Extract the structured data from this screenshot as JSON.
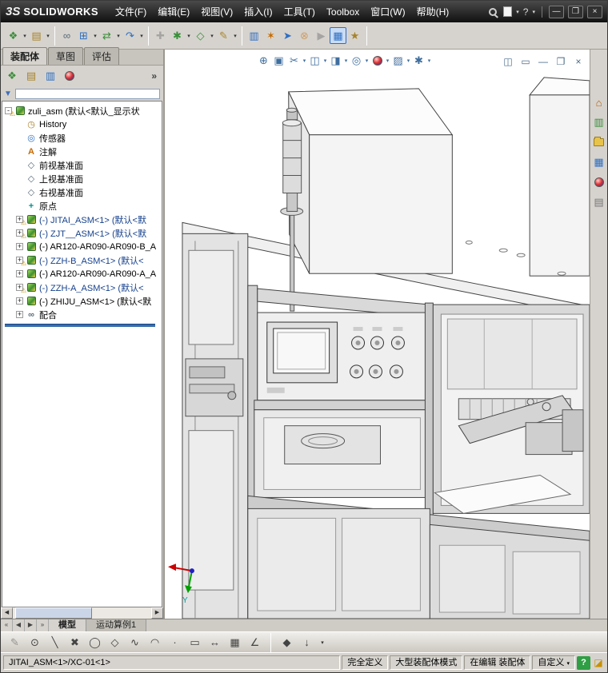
{
  "colors": {
    "accent_blue": "#2d6fc2",
    "tree_green": "#3b8f3b",
    "warning_yellow": "#c79100",
    "rollback_blue": "#3a6ea5",
    "help_green": "#2f9e44"
  },
  "titlebar": {
    "logo_mark": "3S",
    "logo_text": "SOLIDWORKS",
    "menus": [
      "文件(F)",
      "编辑(E)",
      "视图(V)",
      "插入(I)",
      "工具(T)",
      "Toolbox",
      "窗口(W)",
      "帮助(H)"
    ]
  },
  "icons": {
    "dropdown": "▾",
    "minimize": "—",
    "restore": "❐",
    "close": "×",
    "help": "?",
    "chevron": "»",
    "warning": "⚠",
    "history": "◷",
    "sensors": "◎",
    "annotations": "A",
    "plane": "◇",
    "origin": "+",
    "mates": "∞",
    "filter": "▼",
    "scroll_left": "◀",
    "scroll_right": "▶",
    "tip": "◪"
  },
  "toolbar": {
    "icons": [
      {
        "n": "insert-components",
        "g": "❖",
        "dd": true
      },
      {
        "n": "open-document",
        "g": "▤",
        "dd": true
      },
      {
        "n": "mate",
        "g": "∞",
        "dd": false
      },
      {
        "n": "linear-component-pattern",
        "g": "⊞",
        "dd": true
      },
      {
        "n": "move-component",
        "g": "⇄",
        "dd": true
      },
      {
        "n": "rotate-component",
        "g": "↷",
        "dd": true
      },
      {
        "n": "smart-fasteners",
        "g": "✚",
        "dd": false
      },
      {
        "n": "assembly-features",
        "g": "✱",
        "dd": true
      },
      {
        "n": "reference-geometry",
        "g": "◇",
        "dd": true
      },
      {
        "n": "new-sketch",
        "g": "✎",
        "dd": true
      },
      {
        "n": "bill-of-materials",
        "g": "▥",
        "dd": false
      },
      {
        "n": "exploded-view",
        "g": "✶",
        "dd": false
      },
      {
        "n": "explode-line-sketch",
        "g": "➤",
        "dd": false
      },
      {
        "n": "interference-detection",
        "g": "⊗",
        "dd": false
      },
      {
        "n": "simulation",
        "g": "▶",
        "dd": false
      },
      {
        "n": "large-assembly-mode",
        "g": "▦",
        "dd": false
      },
      {
        "n": "motion-manager",
        "g": "★",
        "dd": false
      }
    ]
  },
  "commandmanager": {
    "tabs": [
      "装配体",
      "草图",
      "评估"
    ]
  },
  "fm_toolbar": {
    "icons": [
      {
        "n": "featuremanager-tree",
        "g": "❖"
      },
      {
        "n": "propertymanager",
        "g": "▤"
      },
      {
        "n": "configurationmanager",
        "g": "▥"
      }
    ]
  },
  "featuretree": {
    "rows": [
      {
        "label": "zuli_asm (默认<默认_显示状",
        "exp": "-"
      },
      {
        "label": "History"
      },
      {
        "label": "传感器"
      },
      {
        "label": "注解"
      },
      {
        "label": "前视基准面"
      },
      {
        "label": "上视基准面"
      },
      {
        "label": "右视基准面"
      },
      {
        "label": "原点"
      },
      {
        "label": "(-) JITAI_ASM<1> (默认<默",
        "exp": "+"
      },
      {
        "label": "(-) ZJT__ASM<1> (默认<默",
        "exp": "+"
      },
      {
        "label": "(-) AR120-AR090-AR090-B_A",
        "exp": "+"
      },
      {
        "label": "(-) ZZH-B_ASM<1> (默认<",
        "exp": "+"
      },
      {
        "label": "(-) AR120-AR090-AR090-A_A",
        "exp": "+"
      },
      {
        "label": "(-) ZZH-A_ASM<1> (默认<",
        "exp": "+"
      },
      {
        "label": "(-) ZHIJU_ASM<1> (默认<默",
        "exp": "+"
      },
      {
        "label": "配合",
        "exp": "+"
      }
    ]
  },
  "viewport": {
    "headsup": [
      {
        "n": "zoom-fit",
        "g": "⊕"
      },
      {
        "n": "zoom-to-area",
        "g": "▣"
      },
      {
        "n": "section-view",
        "g": "✂"
      },
      {
        "n": "view-orientation",
        "g": "◫"
      },
      {
        "n": "display-style",
        "g": "◨"
      },
      {
        "n": "hide-show-items",
        "g": "◎"
      },
      {
        "n": "apply-scene",
        "g": "▨"
      },
      {
        "n": "view-settings",
        "g": "✱"
      }
    ],
    "win_ctrls": [
      {
        "n": "split-pane",
        "g": "◫"
      },
      {
        "n": "tile-windows",
        "g": "▭"
      },
      {
        "n": "minimize-doc",
        "g": "—"
      },
      {
        "n": "restore-doc",
        "g": "❐"
      },
      {
        "n": "close-doc",
        "g": "×"
      }
    ],
    "triad_label": "Y"
  },
  "taskpane": {
    "resources": "⌂",
    "design_library": "▥",
    "view_palette": "▦",
    "custom_properties": "▤"
  },
  "doc_tabs": {
    "nav": [
      "«",
      "◀",
      "▶",
      "»"
    ],
    "tabs": [
      "模型",
      "运动算例1"
    ]
  },
  "sketchbar": {
    "icons": [
      {
        "n": "sketch",
        "g": "✎"
      },
      {
        "n": "circle-tool",
        "g": "⊙"
      },
      {
        "n": "line-tool",
        "g": "╲"
      },
      {
        "n": "trim-tool",
        "g": "✖"
      },
      {
        "n": "ellipse-tool",
        "g": "◯"
      },
      {
        "n": "polygon-tool",
        "g": "◇"
      },
      {
        "n": "spline-tool",
        "g": "∿"
      },
      {
        "n": "arc-tool",
        "g": "◠"
      },
      {
        "n": "point-tool",
        "g": "·"
      },
      {
        "n": "rectangle-tool",
        "g": "▭"
      },
      {
        "n": "smart-dimension",
        "g": "↔"
      },
      {
        "n": "grid-pattern",
        "g": "▦"
      },
      {
        "n": "angle-dimension",
        "g": "∠"
      },
      {
        "n": "iso-cube",
        "g": "◆"
      },
      {
        "n": "more-tools",
        "g": "↓"
      }
    ]
  },
  "statusbar": {
    "path": "JITAI_ASM<1>/XC-01<1>",
    "seg_defined": "完全定义",
    "seg_lam": "大型装配体模式",
    "seg_editing": "在编辑 装配体",
    "seg_custom": "自定义",
    "help": "?"
  }
}
